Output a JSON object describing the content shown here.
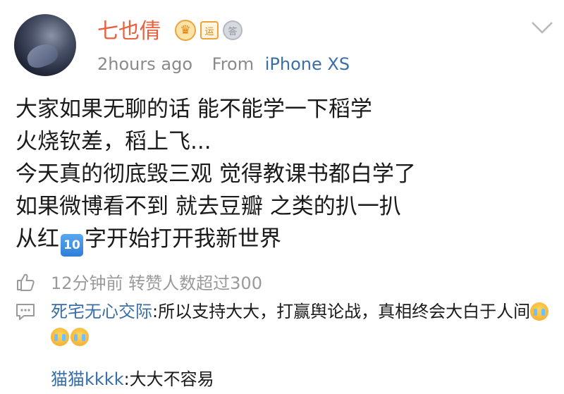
{
  "post": {
    "username": "七也倩",
    "badges": {
      "crown_icon": "crown-badge-icon",
      "yun_label": "运",
      "medal_label": "答",
      "medal_icon": "medal-badge-icon"
    },
    "time": "2hours ago",
    "from_label": "From",
    "device": "iPhone XS",
    "body_lines": [
      "大家如果无聊的话 能不能学一下稻学",
      "火烧钦差，稻上飞...",
      "今天真的彻底毁三观 觉得教课书都白学了",
      "如果微博看不到 就去豆瓣 之类的扒一扒"
    ],
    "last_line_before": "从红",
    "last_line_emoji": "10",
    "last_line_after": "字开始打开我新世界"
  },
  "stats": {
    "like_text": "12分钟前 转赞人数超过300"
  },
  "comments": [
    {
      "name": "死宅无心交际",
      "text": ":所以支持大大，打赢舆论战，真相终会大白于人间",
      "emoji_icon": "crying-face-icon"
    },
    {
      "name": "猫猫kkkk",
      "text": ":大大不容易"
    }
  ],
  "colors": {
    "username": "#e8603c",
    "link_blue": "#3a6ea8",
    "meta_gray": "#8a8a8a"
  }
}
